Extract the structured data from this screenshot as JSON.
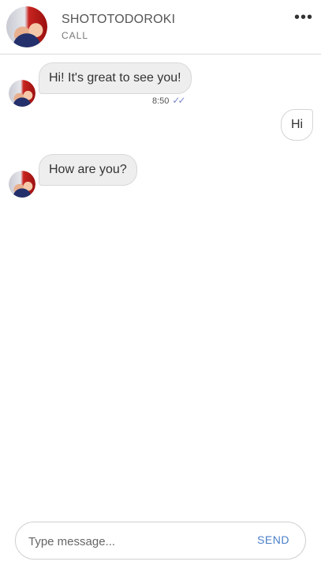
{
  "header": {
    "contact_name": "SHOTOTODOROKI",
    "subtitle": "CALL",
    "more_label": "•••"
  },
  "messages": [
    {
      "direction": "incoming",
      "text": "Hi! It's great to see you!",
      "time": "8:50",
      "status": "read"
    },
    {
      "direction": "outgoing",
      "text": "Hi"
    },
    {
      "direction": "incoming",
      "text": "How are you?"
    }
  ],
  "ticks_glyph": "✓✓",
  "composer": {
    "placeholder": "Type message...",
    "value": "",
    "send_label": "SEND"
  },
  "colors": {
    "accent": "#4a7fc8",
    "read_ticks": "#7a86c8",
    "incoming_bubble": "#eeeeee",
    "divider": "#dcdcdc"
  }
}
